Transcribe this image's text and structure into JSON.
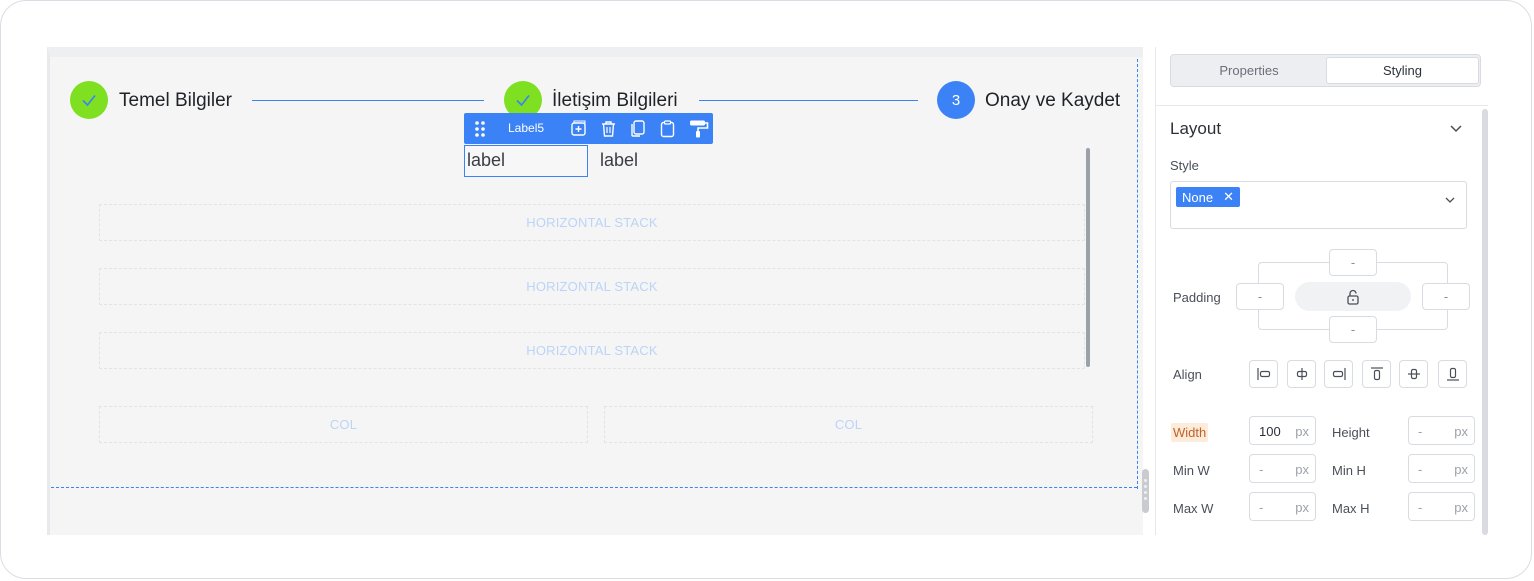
{
  "stepper": {
    "steps": [
      {
        "label": "Temel Bilgiler",
        "state": "done",
        "icon": "check-icon"
      },
      {
        "label": "İletişim Bilgileri",
        "state": "done",
        "icon": "check-icon"
      },
      {
        "label": "Onay ve Kaydet",
        "state": "active",
        "number": "3"
      }
    ],
    "colors": {
      "done": "#7ee021",
      "active": "#3b82f6"
    }
  },
  "toolbar": {
    "component_name": "Label5",
    "icons": [
      "drag-handle-icon",
      "add-icon",
      "trash-icon",
      "copy-icon",
      "paste-icon",
      "paint-roller-icon"
    ]
  },
  "canvas": {
    "label_input_value": "label",
    "label_text": "label",
    "stacks": [
      "HORIZONTAL STACK",
      "HORIZONTAL STACK",
      "HORIZONTAL STACK"
    ],
    "cols": [
      "COL",
      "COL"
    ]
  },
  "panel": {
    "tabs": [
      {
        "label": "Properties",
        "selected": false
      },
      {
        "label": "Styling",
        "selected": true
      }
    ],
    "layout": {
      "title": "Layout",
      "style_label": "Style",
      "style_chip": "None",
      "style_chip_remove": "✕",
      "padding_label": "Padding",
      "padding": {
        "top": "-",
        "left": "-",
        "right": "-",
        "bottom": "-"
      },
      "align_label": "Align",
      "align_icons": [
        "align-left-icon",
        "align-center-h-icon",
        "align-right-icon",
        "align-top-icon",
        "align-center-v-icon",
        "align-bottom-icon"
      ],
      "width_label": "Width",
      "width_value": "100",
      "height_label": "Height",
      "height_value": "-",
      "min_w_label": "Min W",
      "min_w_value": "-",
      "min_h_label": "Min H",
      "min_h_value": "-",
      "max_w_label": "Max W",
      "max_w_value": "-",
      "max_h_label": "Max H",
      "max_h_value": "-",
      "unit": "px"
    }
  },
  "accent_color": "#3b82f6"
}
